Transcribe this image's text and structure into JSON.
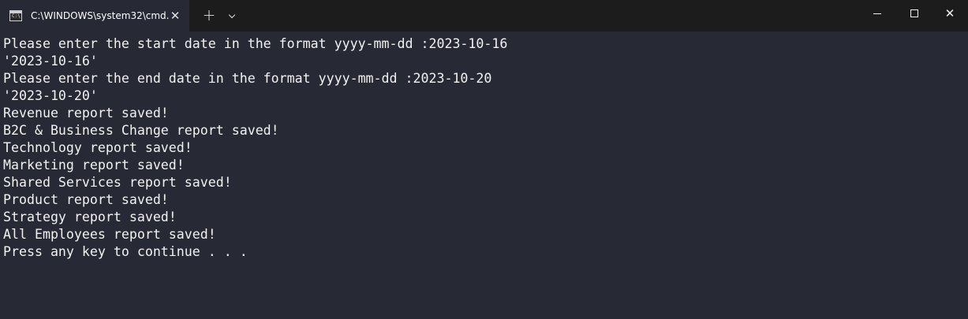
{
  "window": {
    "tab_title": "C:\\WINDOWS\\system32\\cmd.",
    "tab_icon": "cmd-icon",
    "tab_icon_glyph": "C:\\",
    "close_tab_glyph": "✕",
    "new_tab_glyph": "+",
    "close_window_glyph": "✕"
  },
  "colors": {
    "titlebar": "#1c1c1c",
    "console_background": "#272935",
    "console_text": "#f2f2f2"
  },
  "console": {
    "lines": [
      "Please enter the start date in the format yyyy-mm-dd :2023-10-16",
      "'2023-10-16'",
      "Please enter the end date in the format yyyy-mm-dd :2023-10-20",
      "'2023-10-20'",
      "Revenue report saved!",
      "B2C & Business Change report saved!",
      "Technology report saved!",
      "Marketing report saved!",
      "Shared Services report saved!",
      "Product report saved!",
      "Strategy report saved!",
      "All Employees report saved!",
      "Press any key to continue . . ."
    ]
  }
}
